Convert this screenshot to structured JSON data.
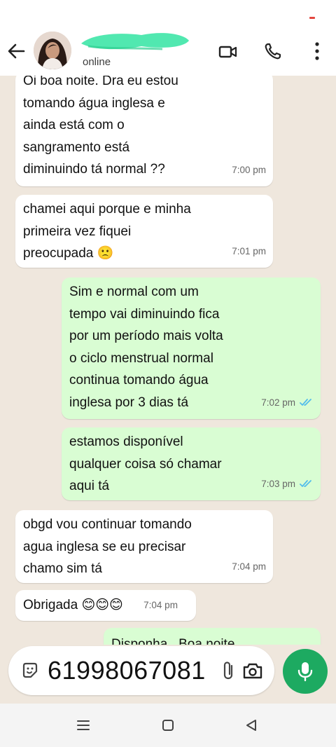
{
  "header": {
    "contact_name": "",
    "contact_status": "online",
    "icons": [
      "back-arrow-icon",
      "avatar",
      "video-call-icon",
      "phone-icon",
      "more-vertical-icon"
    ]
  },
  "messages": [
    {
      "direction": "in",
      "text": "Oi boa noite. Dra eu estou\ntomando água inglesa e\nainda está com o\nsangramento está\ndiminuindo tá normal ??",
      "time": "7:00 pm"
    },
    {
      "direction": "in",
      "text": "chamei aqui porque e minha\nprimeira vez fiquei\npreocupada 🙁",
      "time": "7:01 pm"
    },
    {
      "direction": "out",
      "text": "Sim e normal com um\ntempo vai diminuindo fica\npor um período mais volta\no ciclo menstrual normal\ncontinua tomando água\ninglesa por 3 dias tá",
      "time": "7:02 pm",
      "read": true
    },
    {
      "direction": "out",
      "text": "estamos disponível\nqualquer coisa só chamar\naqui tá",
      "time": "7:03 pm",
      "read": true
    },
    {
      "direction": "in",
      "text": "obgd vou continuar tomando\nagua inglesa se eu precisar\nchamo sim tá",
      "time": "7:04 pm"
    },
    {
      "direction": "in",
      "text": "Obrigada 😊😊😊",
      "time": "7:04 pm"
    },
    {
      "direction": "out",
      "text": "Disponha . Boa noite",
      "time": "",
      "read": true
    }
  ],
  "input": {
    "value": "61998067081",
    "placeholder": ""
  },
  "colors": {
    "chat_background": "#efe7dd",
    "incoming_bubble": "#ffffff",
    "outgoing_bubble": "#d9fdd3",
    "accent": "#1daa61",
    "read_ticks": "#53bdeb"
  }
}
